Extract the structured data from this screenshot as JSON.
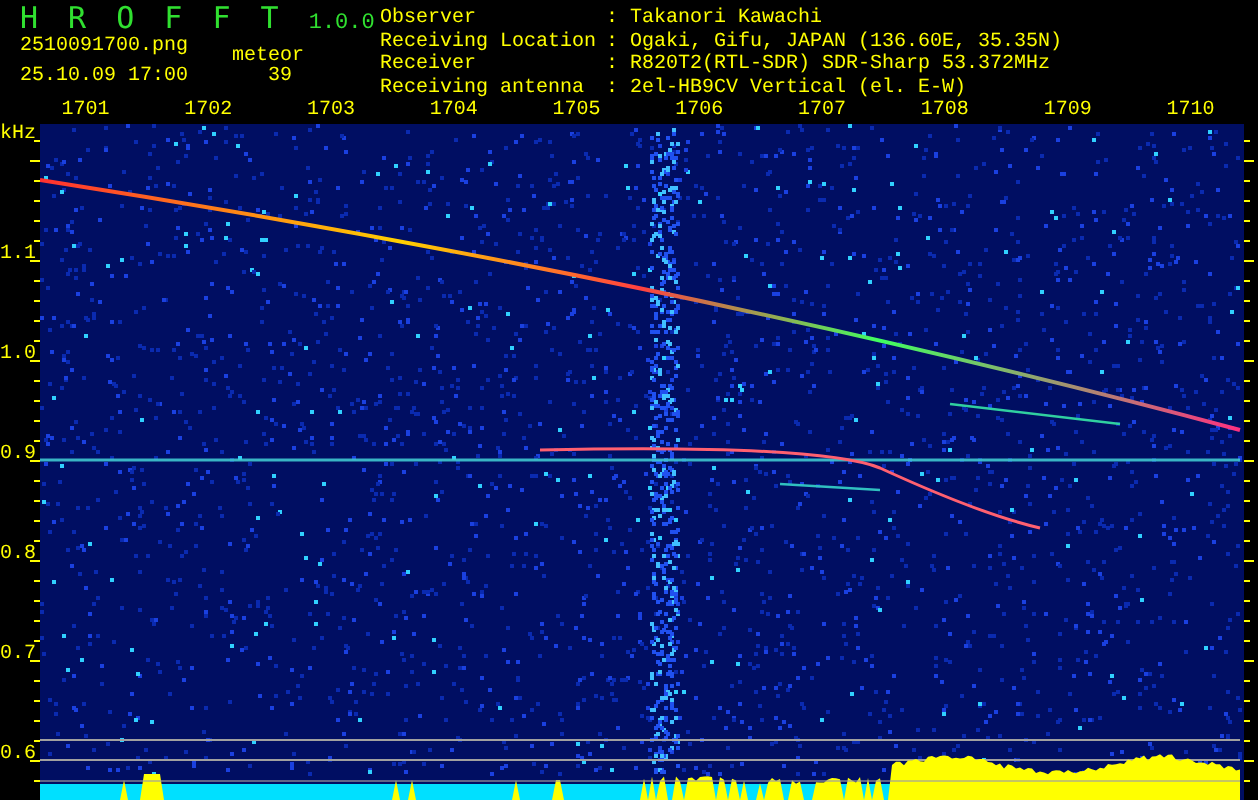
{
  "header": {
    "app_name": "H R O F F T",
    "version": "1.0.0",
    "filename": "2510091700.png",
    "timestamp": "25.10.09 17:00",
    "count_label": "meteor",
    "count": "39"
  },
  "station_info": [
    {
      "label": "Observer",
      "separator": ":",
      "value": "Takanori Kawachi"
    },
    {
      "label": "Receiving Location",
      "separator": ":",
      "value": "Ogaki, Gifu, JAPAN (136.60E, 35.35N)"
    },
    {
      "label": "Receiver",
      "separator": ":",
      "value": "R820T2(RTL-SDR) SDR-Sharp 53.372MHz"
    },
    {
      "label": "Receiving antenna",
      "separator": ":",
      "value": "2el-HB9CV Vertical (el. E-W)"
    }
  ],
  "spectrogram": {
    "unit": "kHz",
    "x_labels": [
      "1701",
      "1702",
      "1703",
      "1704",
      "1705",
      "1706",
      "1707",
      "1708",
      "1709",
      "1710"
    ],
    "y_labels": [
      "1.1",
      "1.0",
      "0.9",
      "0.8",
      "0.7",
      "0.6"
    ]
  }
}
